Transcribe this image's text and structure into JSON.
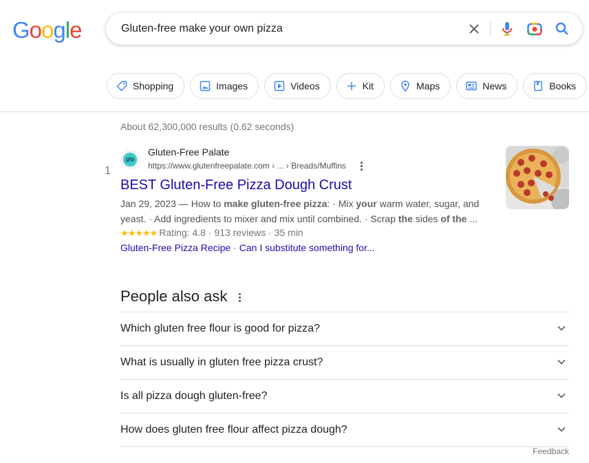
{
  "logo": {
    "letters": [
      "G",
      "o",
      "o",
      "g",
      "l",
      "e"
    ],
    "colors": [
      "#4285f4",
      "#ea4335",
      "#fbbc05",
      "#4285f4",
      "#34a853",
      "#ea4335"
    ]
  },
  "search": {
    "value": "Gluten-free make your own pizza",
    "icons": [
      "clear-icon",
      "mic-icon",
      "lens-icon",
      "search-icon"
    ]
  },
  "chips": [
    {
      "label": "Shopping",
      "icon": "tag-icon"
    },
    {
      "label": "Images",
      "icon": "image-icon"
    },
    {
      "label": "Videos",
      "icon": "play-icon"
    },
    {
      "label": "Kit",
      "icon": "plus-icon"
    },
    {
      "label": "Maps",
      "icon": "map-pin-icon"
    },
    {
      "label": "News",
      "icon": "news-icon"
    },
    {
      "label": "Books",
      "icon": "book-icon"
    }
  ],
  "stats": "About 62,300,000 results (0.62 seconds)",
  "result": {
    "rank": "1",
    "site_name": "Gluten-Free Palate",
    "url": "https://www.glutenfreepalate.com › ... › Breads/Muffins",
    "title": "BEST Gluten-Free Pizza Dough Crust",
    "snippet_line1": [
      {
        "t": "Jan 29, 2023 — How to ",
        "b": false
      },
      {
        "t": "make gluten-free pizza",
        "b": true
      },
      {
        "t": ": · Mix ",
        "b": false
      },
      {
        "t": "your",
        "b": true
      },
      {
        "t": " warm water, sugar, and",
        "b": false
      }
    ],
    "snippet_line2": [
      {
        "t": "yeast. · Add ingredients to mixer and mix until combined. · Scrap ",
        "b": false
      },
      {
        "t": "the",
        "b": true
      },
      {
        "t": " sides ",
        "b": false
      },
      {
        "t": "of the",
        "b": true
      },
      {
        "t": " ...",
        "b": false
      }
    ],
    "stars": "★★★★★",
    "rating_text": "Rating: 4.8 · 913 reviews · 35 min",
    "sitelinks": [
      "Gluten-Free Pizza Recipe",
      "Can I substitute something for..."
    ],
    "sitelink_sep": " · "
  },
  "paa": {
    "heading": "People also ask",
    "questions": [
      "Which gluten free flour is good for pizza?",
      "What is usually in gluten free pizza crust?",
      "Is all pizza dough gluten-free?",
      "How does gluten free flour affect pizza dough?"
    ]
  },
  "feedback": "Feedback"
}
